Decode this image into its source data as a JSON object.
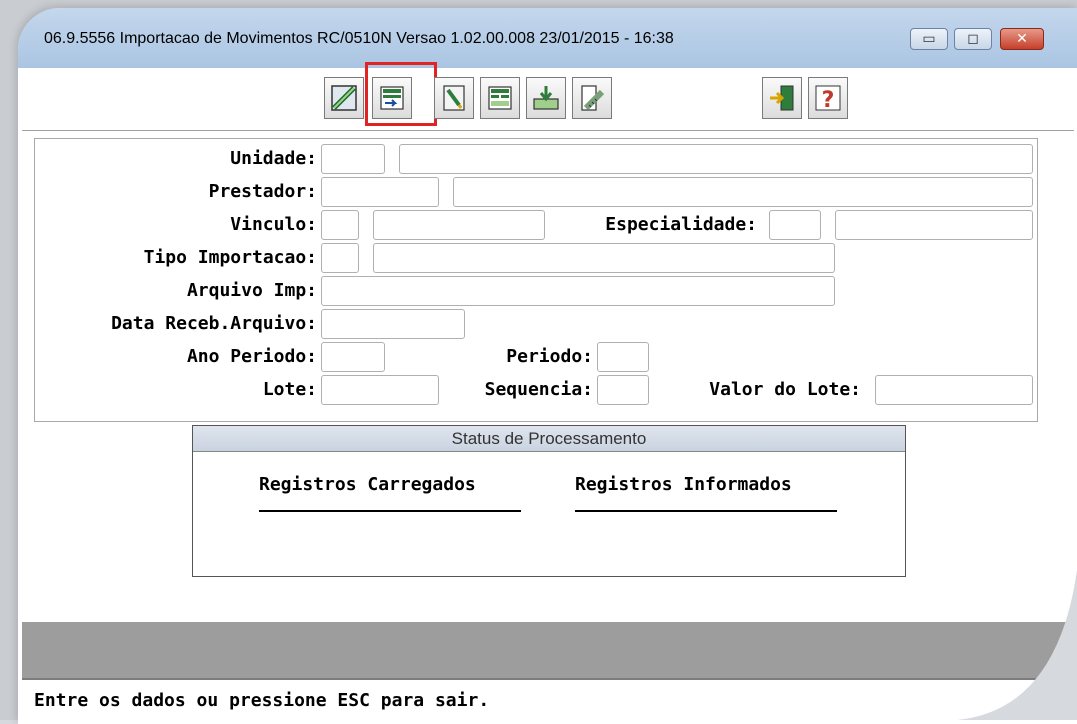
{
  "window": {
    "title": "06.9.5556 Importacao de  Movimentos RC/0510N Versao 1.02.00.008 23/01/2015 - 16:38",
    "minimize_glyph": "▭",
    "maximize_glyph": "◻",
    "close_glyph": "✕"
  },
  "toolbar": {
    "buttons": [
      {
        "icon": "edit-icon"
      },
      {
        "icon": "import-icon"
      },
      {
        "icon": "note-icon"
      },
      {
        "icon": "list-icon"
      },
      {
        "icon": "download-icon"
      },
      {
        "icon": "ruler-icon"
      },
      {
        "icon": "exit-icon"
      },
      {
        "icon": "help-icon"
      }
    ],
    "highlight_color": "#e02424"
  },
  "form": {
    "unidade_label": "Unidade:",
    "prestador_label": "Prestador:",
    "vinculo_label": "Vinculo:",
    "especialidade_label": "Especialidade:",
    "tipo_importacao_label": "Tipo Importacao:",
    "arquivo_imp_label": "Arquivo Imp:",
    "data_receb_label": "Data Receb.Arquivo:",
    "ano_periodo_label": "Ano Periodo:",
    "periodo_label": "Periodo:",
    "lote_label": "Lote:",
    "sequencia_label": "Sequencia:",
    "valor_lote_label": "Valor do Lote:"
  },
  "status": {
    "title": "Status de Processamento",
    "registros_carregados": "Registros Carregados",
    "registros_informados": "Registros Informados"
  },
  "footer": {
    "message": "Entre os dados ou pressione ESC para sair."
  }
}
